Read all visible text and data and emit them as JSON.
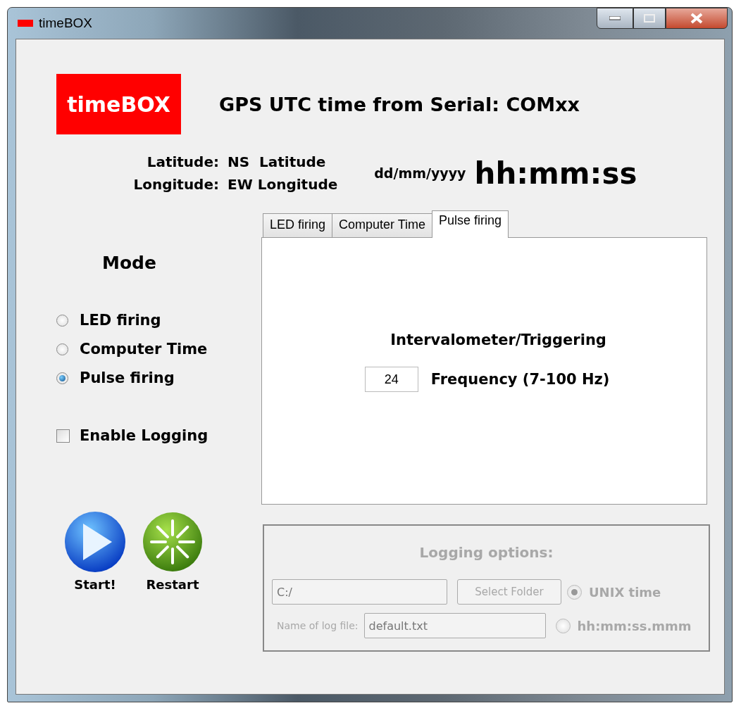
{
  "window": {
    "title": "timeBOX"
  },
  "header": {
    "logo": "timeBOX",
    "title": "GPS UTC time from Serial: COMxx",
    "latitude_label": "Latitude:",
    "latitude_value": "NS  Latitude",
    "longitude_label": "Longitude:",
    "longitude_value": "EW Longitude",
    "date": "dd/mm/yyyy",
    "time": "hh:mm:ss"
  },
  "mode": {
    "title": "Mode",
    "options": [
      {
        "label": "LED firing",
        "selected": false
      },
      {
        "label": "Computer Time",
        "selected": false
      },
      {
        "label": "Pulse firing",
        "selected": true
      }
    ]
  },
  "enable_logging": {
    "label": "Enable Logging",
    "checked": false
  },
  "actions": [
    {
      "kind": "start",
      "label": "Start!"
    },
    {
      "kind": "restart",
      "label": "Restart"
    }
  ],
  "tabs": [
    {
      "label": "LED firing",
      "selected": false
    },
    {
      "label": "Computer Time",
      "selected": false
    },
    {
      "label": "Pulse firing",
      "selected": true
    }
  ],
  "panel": {
    "heading": "Intervalometer/Triggering",
    "frequency_value": "24",
    "frequency_label": "Frequency (7-100 Hz)"
  },
  "logging_options": {
    "title": "Logging options:",
    "disabled": true,
    "folder_value": "C:/",
    "select_button": "Select Folder",
    "file_label": "Name of log file:",
    "file_value": "default.txt",
    "formats": [
      {
        "label": "UNIX time",
        "selected": true
      },
      {
        "label": "hh:mm:ss.mmm",
        "selected": false
      }
    ]
  }
}
